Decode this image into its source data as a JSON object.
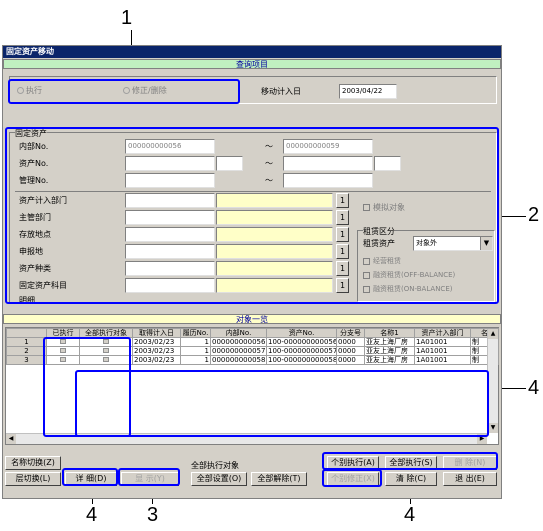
{
  "callouts": {
    "c1": "1",
    "c2": "2",
    "c3": "3",
    "c4a": "4",
    "c4b": "4",
    "c4c": "4"
  },
  "window": {
    "title": "固定资产移动"
  },
  "header_section": {
    "title": "查询项目",
    "radio_execute": "执行",
    "radio_correct": "修正/删除",
    "date_label": "移动计入日",
    "date_value": "2003/04/22"
  },
  "asset_group": {
    "title": "固定资产",
    "internal_no_label": "内部No.",
    "internal_no_from": "000000000056",
    "internal_no_to": "000000000059",
    "asset_no_label": "资产No.",
    "mgmt_no_label": "管理No.",
    "tilde": "～",
    "dept_label": "资产计入部门",
    "owner_dept_label": "主管部门",
    "location_label": "存放地点",
    "report_label": "申报地",
    "asset_type_label": "资产种类",
    "account_label": "固定资产科目",
    "detail_label": "明细",
    "pick_btn": "1",
    "simulate_label": "模拟对象",
    "lease_title": "租赁区分",
    "lease_asset_label": "租赁资产",
    "lease_select_value": "对象外",
    "lease_op1": "经营租赁",
    "lease_op2": "融资租赁(OFF-BALANCE)",
    "lease_op3": "融资租赁(ON-BALANCE)"
  },
  "list_section": {
    "title": "对象一览",
    "columns": [
      "已执行",
      "全部执行对象",
      "取得计入日",
      "履历No.",
      "内部No.",
      "资产No.",
      "分支号",
      "名称1",
      "资产计入部门",
      "名"
    ],
    "rows": [
      {
        "num": "1",
        "date": "2003/02/23",
        "hist": "1",
        "internal": "000000000056",
        "asset": "100-000000000056",
        "branch": "0000",
        "name": "亚友上海厂房",
        "dept": "1A01001",
        "extra": "制"
      },
      {
        "num": "2",
        "date": "2003/02/23",
        "hist": "1",
        "internal": "000000000057",
        "asset": "100-000000000057",
        "branch": "0000",
        "name": "亚友上海厂房",
        "dept": "1A01001",
        "extra": "制"
      },
      {
        "num": "3",
        "date": "2003/02/23",
        "hist": "1",
        "internal": "000000000058",
        "asset": "100-000000000058",
        "branch": "0000",
        "name": "亚友上海厂房",
        "dept": "1A01001",
        "extra": "制"
      }
    ]
  },
  "footer": {
    "name_switch": "名称切换(Z)",
    "layer_switch": "层切换(L)",
    "detail": "详 细(D)",
    "display": "显 示(Y)",
    "all_exec_title": "全部执行对象",
    "all_set": "全部设置(O)",
    "all_clear": "全部解除(T)",
    "individual_exec": "个别执行(A)",
    "all_exec": "全部执行(S)",
    "delete": "删 除(N)",
    "individual_fix": "个别修正(X)",
    "clear": "清 除(C)",
    "exit": "退 出(E)"
  }
}
